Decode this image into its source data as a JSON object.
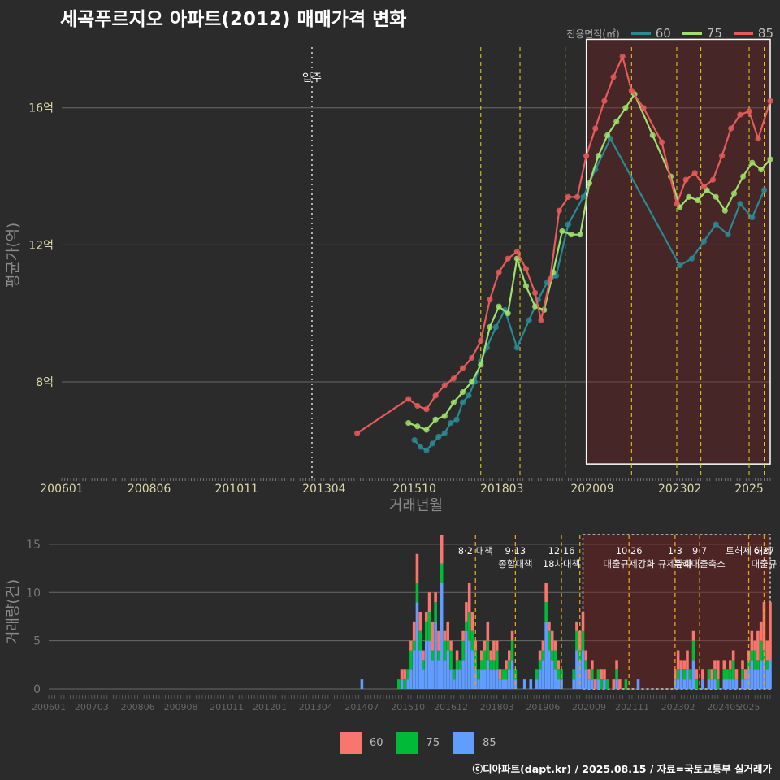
{
  "title": "세곡푸르지오 아파트(2012) 매매가격 변화",
  "caption": "ⓒ디아파트(dapt.kr) / 2025.08.15 / 자료=국토교통부 실거래가",
  "legend_top": {
    "title": "전용면적(㎡)",
    "items": [
      {
        "label": "60",
        "color": "#2a8a93"
      },
      {
        "label": "75",
        "color": "#9ee06c"
      },
      {
        "label": "85",
        "color": "#e85a5a"
      }
    ]
  },
  "legend_bottom": {
    "items": [
      {
        "label": "60",
        "color": "#f8766d"
      },
      {
        "label": "75",
        "color": "#00ba38"
      },
      {
        "label": "85",
        "color": "#619cff"
      }
    ]
  },
  "chart_data": [
    {
      "type": "line",
      "xlabel": "거래년월",
      "ylabel": "평균가(억)",
      "x_range": [
        "2006-01",
        "2025-08"
      ],
      "ylim": [
        5.2,
        18.2
      ],
      "y_ticks": [
        {
          "v": 8,
          "label": "8억"
        },
        {
          "v": 12,
          "label": "12억"
        },
        {
          "v": 16,
          "label": "16억"
        }
      ],
      "x_ticks": [
        "200601",
        "200806",
        "201011",
        "201304",
        "201510",
        "201803",
        "202009",
        "202302",
        "2025"
      ],
      "grid": true,
      "annotation": {
        "label": "입주",
        "x": "2012-12"
      },
      "policy_lines": [
        "2017-08",
        "2018-09",
        "2019-12",
        "2021-10",
        "2023-01",
        "2023-09",
        "2025-01",
        "2025-06"
      ],
      "highlight_box": {
        "from": "2020-07",
        "to": "2025-08",
        "ymin": 5.6,
        "ymax": 18.0
      },
      "series": [
        {
          "name": "60",
          "color": "#2a8a93",
          "points": [
            [
              "2015-10",
              6.3
            ],
            [
              "2015-12",
              6.1
            ],
            [
              "2016-02",
              6.0
            ],
            [
              "2016-04",
              6.2
            ],
            [
              "2016-06",
              6.4
            ],
            [
              "2016-08",
              6.5
            ],
            [
              "2016-10",
              6.8
            ],
            [
              "2016-12",
              6.9
            ],
            [
              "2017-02",
              7.4
            ],
            [
              "2017-04",
              7.6
            ],
            [
              "2017-06",
              8.0
            ],
            [
              "2017-08",
              8.6
            ],
            [
              "2017-10",
              9.0
            ],
            [
              "2018-01",
              9.6
            ],
            [
              "2018-04",
              10.1
            ],
            [
              "2018-08",
              9.0
            ],
            [
              "2018-12",
              9.8
            ],
            [
              "2019-03",
              10.4
            ],
            [
              "2019-06",
              10.9
            ],
            [
              "2019-09",
              11.1
            ],
            [
              "2020-01",
              12.6
            ],
            [
              "2020-06",
              13.4
            ],
            [
              "2020-10",
              14.2
            ],
            [
              "2021-03",
              15.1
            ],
            [
              "2023-02",
              11.4
            ],
            [
              "2023-06",
              11.6
            ],
            [
              "2023-10",
              12.1
            ],
            [
              "2024-02",
              12.6
            ],
            [
              "2024-06",
              12.3
            ],
            [
              "2024-10",
              13.2
            ],
            [
              "2025-02",
              12.8
            ],
            [
              "2025-06",
              13.6
            ]
          ]
        },
        {
          "name": "75",
          "color": "#9ee06c",
          "points": [
            [
              "2015-08",
              6.8
            ],
            [
              "2015-11",
              6.7
            ],
            [
              "2016-02",
              6.6
            ],
            [
              "2016-05",
              6.9
            ],
            [
              "2016-08",
              7.0
            ],
            [
              "2016-11",
              7.4
            ],
            [
              "2017-02",
              7.7
            ],
            [
              "2017-05",
              8.0
            ],
            [
              "2017-08",
              8.5
            ],
            [
              "2017-11",
              9.6
            ],
            [
              "2018-02",
              10.2
            ],
            [
              "2018-05",
              10.0
            ],
            [
              "2018-08",
              11.6
            ],
            [
              "2018-11",
              10.8
            ],
            [
              "2019-02",
              10.2
            ],
            [
              "2019-05",
              10.1
            ],
            [
              "2019-08",
              11.2
            ],
            [
              "2019-11",
              12.4
            ],
            [
              "2020-02",
              12.3
            ],
            [
              "2020-05",
              12.3
            ],
            [
              "2020-08",
              13.8
            ],
            [
              "2020-11",
              14.6
            ],
            [
              "2021-02",
              15.2
            ],
            [
              "2021-05",
              15.6
            ],
            [
              "2021-08",
              16.0
            ],
            [
              "2021-11",
              16.4
            ],
            [
              "2022-05",
              15.2
            ],
            [
              "2022-11",
              14.0
            ],
            [
              "2023-02",
              13.1
            ],
            [
              "2023-05",
              13.4
            ],
            [
              "2023-08",
              13.3
            ],
            [
              "2023-11",
              13.6
            ],
            [
              "2024-02",
              13.4
            ],
            [
              "2024-05",
              13.0
            ],
            [
              "2024-08",
              13.5
            ],
            [
              "2024-11",
              14.0
            ],
            [
              "2025-02",
              14.4
            ],
            [
              "2025-05",
              14.2
            ],
            [
              "2025-08",
              14.5
            ]
          ]
        },
        {
          "name": "85",
          "color": "#e85a5a",
          "points": [
            [
              "2014-03",
              6.5
            ],
            [
              "2015-08",
              7.5
            ],
            [
              "2015-11",
              7.3
            ],
            [
              "2016-02",
              7.2
            ],
            [
              "2016-05",
              7.6
            ],
            [
              "2016-08",
              7.9
            ],
            [
              "2016-11",
              8.1
            ],
            [
              "2017-02",
              8.4
            ],
            [
              "2017-05",
              8.7
            ],
            [
              "2017-08",
              9.2
            ],
            [
              "2017-11",
              10.4
            ],
            [
              "2018-02",
              11.2
            ],
            [
              "2018-05",
              11.6
            ],
            [
              "2018-08",
              11.8
            ],
            [
              "2018-11",
              11.3
            ],
            [
              "2019-02",
              10.6
            ],
            [
              "2019-04",
              9.8
            ],
            [
              "2019-07",
              11.0
            ],
            [
              "2019-10",
              13.0
            ],
            [
              "2020-01",
              13.4
            ],
            [
              "2020-04",
              13.4
            ],
            [
              "2020-07",
              14.6
            ],
            [
              "2020-10",
              15.4
            ],
            [
              "2021-01",
              16.2
            ],
            [
              "2021-04",
              16.9
            ],
            [
              "2021-07",
              17.5
            ],
            [
              "2021-10",
              16.5
            ],
            [
              "2022-02",
              16.0
            ],
            [
              "2022-08",
              15.0
            ],
            [
              "2023-01",
              13.2
            ],
            [
              "2023-04",
              13.9
            ],
            [
              "2023-07",
              14.1
            ],
            [
              "2023-10",
              13.7
            ],
            [
              "2024-01",
              13.9
            ],
            [
              "2024-04",
              14.6
            ],
            [
              "2024-07",
              15.4
            ],
            [
              "2024-10",
              15.8
            ],
            [
              "2025-01",
              15.9
            ],
            [
              "2025-04",
              15.1
            ],
            [
              "2025-08",
              16.2
            ]
          ]
        }
      ]
    },
    {
      "type": "bar",
      "stacked": true,
      "ylabel": "거래량(건)",
      "x_range": [
        "2006-01",
        "2025-08"
      ],
      "ylim": [
        0,
        16
      ],
      "y_ticks": [
        0,
        5,
        10,
        15
      ],
      "x_ticks": [
        "200601",
        "200703",
        "200806",
        "200908",
        "201011",
        "201201",
        "201304",
        "201407",
        "201510",
        "201612",
        "201803",
        "201906",
        "202009",
        "202111",
        "202302",
        "202405",
        "2025"
      ],
      "highlight_box": {
        "from": "2020-07",
        "to": "2025-08"
      },
      "policy_lines": [
        {
          "x": "2017-08",
          "labels": [
            "8·2 대책"
          ]
        },
        {
          "x": "2018-09",
          "labels": [
            "9·13",
            "종합대책"
          ]
        },
        {
          "x": "2019-12",
          "labels": [
            "12·16",
            "18차대책"
          ]
        },
        {
          "x": "2020-06",
          "labels": []
        },
        {
          "x": "2021-10",
          "labels": [
            "10·26",
            "대출규제강화"
          ]
        },
        {
          "x": "2023-01",
          "labels": [
            "1·3",
            "규제완화"
          ]
        },
        {
          "x": "2023-09",
          "labels": [
            "9·7",
            "특례대출축소"
          ]
        },
        {
          "x": "2025-01",
          "labels": [
            "토허제 해제"
          ]
        },
        {
          "x": "2025-06",
          "labels": [
            "6·27",
            "대출규"
          ]
        }
      ],
      "series_names": [
        "60",
        "75",
        "85"
      ],
      "months": [
        [
          "2014-07",
          0,
          0,
          1
        ],
        [
          "2015-07",
          0,
          1,
          0
        ],
        [
          "2015-08",
          1,
          0,
          1
        ],
        [
          "2015-09",
          1,
          1,
          0
        ],
        [
          "2015-10",
          0,
          1,
          1
        ],
        [
          "2015-11",
          1,
          2,
          2
        ],
        [
          "2015-12",
          2,
          1,
          4
        ],
        [
          "2016-01",
          3,
          2,
          9
        ],
        [
          "2016-02",
          2,
          2,
          4
        ],
        [
          "2016-03",
          1,
          1,
          2
        ],
        [
          "2016-04",
          1,
          2,
          5
        ],
        [
          "2016-05",
          2,
          3,
          5
        ],
        [
          "2016-06",
          3,
          1,
          3
        ],
        [
          "2016-07",
          1,
          2,
          7
        ],
        [
          "2016-08",
          2,
          1,
          3
        ],
        [
          "2016-09",
          3,
          2,
          11
        ],
        [
          "2016-10",
          1,
          2,
          3
        ],
        [
          "2016-11",
          2,
          1,
          4
        ],
        [
          "2016-12",
          1,
          2,
          2
        ],
        [
          "2017-01",
          0,
          1,
          1
        ],
        [
          "2017-02",
          1,
          1,
          2
        ],
        [
          "2017-03",
          0,
          1,
          2
        ],
        [
          "2017-04",
          1,
          2,
          3
        ],
        [
          "2017-05",
          2,
          1,
          6
        ],
        [
          "2017-06",
          3,
          3,
          5
        ],
        [
          "2017-07",
          2,
          2,
          4
        ],
        [
          "2017-08",
          1,
          2,
          2
        ],
        [
          "2017-09",
          0,
          1,
          1
        ],
        [
          "2017-10",
          1,
          1,
          2
        ],
        [
          "2017-11",
          1,
          2,
          2
        ],
        [
          "2017-12",
          2,
          2,
          3
        ],
        [
          "2018-01",
          1,
          1,
          2
        ],
        [
          "2018-02",
          2,
          1,
          2
        ],
        [
          "2018-03",
          1,
          2,
          2
        ],
        [
          "2018-04",
          1,
          0,
          1
        ],
        [
          "2018-05",
          0,
          1,
          1
        ],
        [
          "2018-06",
          1,
          1,
          1
        ],
        [
          "2018-07",
          1,
          1,
          2
        ],
        [
          "2018-08",
          1,
          2,
          3
        ],
        [
          "2018-09",
          0,
          1,
          1
        ],
        [
          "2018-12",
          0,
          0,
          1
        ],
        [
          "2019-02",
          0,
          0,
          1
        ],
        [
          "2019-04",
          0,
          1,
          1
        ],
        [
          "2019-05",
          1,
          1,
          2
        ],
        [
          "2019-06",
          1,
          1,
          3
        ],
        [
          "2019-07",
          2,
          2,
          7
        ],
        [
          "2019-08",
          1,
          2,
          4
        ],
        [
          "2019-09",
          2,
          1,
          3
        ],
        [
          "2019-10",
          1,
          2,
          2
        ],
        [
          "2019-11",
          1,
          1,
          1
        ],
        [
          "2019-12",
          0,
          1,
          1
        ],
        [
          "2020-04",
          0,
          1,
          1
        ],
        [
          "2020-05",
          1,
          2,
          4
        ],
        [
          "2020-06",
          2,
          1,
          3
        ],
        [
          "2020-07",
          2,
          2,
          4
        ],
        [
          "2020-08",
          1,
          1,
          2
        ],
        [
          "2020-09",
          1,
          0,
          1
        ],
        [
          "2020-10",
          1,
          1,
          1
        ],
        [
          "2020-11",
          1,
          0,
          0
        ],
        [
          "2020-12",
          0,
          1,
          1
        ],
        [
          "2021-01",
          1,
          1,
          0
        ],
        [
          "2021-02",
          1,
          0,
          1
        ],
        [
          "2021-03",
          0,
          1,
          0
        ],
        [
          "2021-05",
          1,
          0,
          0
        ],
        [
          "2021-06",
          1,
          1,
          1
        ],
        [
          "2021-07",
          1,
          0,
          0
        ],
        [
          "2021-09",
          0,
          1,
          0
        ],
        [
          "2022-01",
          0,
          0,
          1
        ],
        [
          "2023-01",
          1,
          0,
          1
        ],
        [
          "2023-02",
          2,
          1,
          1
        ],
        [
          "2023-03",
          1,
          0,
          2
        ],
        [
          "2023-04",
          1,
          1,
          1
        ],
        [
          "2023-05",
          2,
          0,
          2
        ],
        [
          "2023-06",
          0,
          1,
          1
        ],
        [
          "2023-07",
          1,
          2,
          3
        ],
        [
          "2023-08",
          1,
          1,
          0
        ],
        [
          "2023-10",
          1,
          0,
          1
        ],
        [
          "2023-12",
          0,
          1,
          1
        ],
        [
          "2024-01",
          1,
          0,
          1
        ],
        [
          "2024-02",
          1,
          1,
          1
        ],
        [
          "2024-03",
          2,
          1,
          0
        ],
        [
          "2024-05",
          1,
          1,
          1
        ],
        [
          "2024-06",
          0,
          1,
          1
        ],
        [
          "2024-07",
          1,
          1,
          1
        ],
        [
          "2024-08",
          1,
          2,
          1
        ],
        [
          "2024-09",
          1,
          0,
          1
        ],
        [
          "2024-11",
          1,
          1,
          1
        ],
        [
          "2024-12",
          1,
          0,
          1
        ],
        [
          "2025-01",
          1,
          1,
          2
        ],
        [
          "2025-02",
          2,
          1,
          3
        ],
        [
          "2025-03",
          1,
          2,
          2
        ],
        [
          "2025-04",
          3,
          1,
          2
        ],
        [
          "2025-05",
          2,
          2,
          3
        ],
        [
          "2025-06",
          5,
          1,
          3
        ],
        [
          "2025-07",
          2,
          1,
          2
        ],
        [
          "2025-08",
          6,
          0,
          3
        ]
      ]
    }
  ]
}
